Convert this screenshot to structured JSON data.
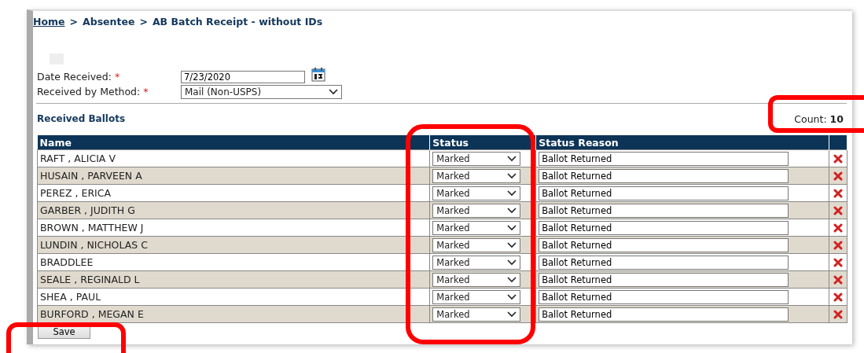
{
  "breadcrumb": [
    {
      "label": "Home",
      "kind": "link"
    },
    {
      "label": ">",
      "kind": "separator"
    },
    {
      "label": "Absentee",
      "kind": "text"
    },
    {
      "label": ">",
      "kind": "separator"
    },
    {
      "label": "AB Batch Receipt - without IDs",
      "kind": "text"
    }
  ],
  "form": {
    "date_received": {
      "label": "Date Received:",
      "required_mark": "*",
      "value": "7/23/2020"
    },
    "received_by_method": {
      "label": "Received by Method:",
      "required_mark": "*",
      "value": "Mail (Non-USPS)"
    }
  },
  "section_title": "Received Ballots",
  "count": {
    "label": "Count:",
    "value": "10"
  },
  "table": {
    "columns": [
      "Name",
      "Status",
      "Status Reason"
    ],
    "rows": [
      {
        "name": "RAFT , ALICIA V",
        "status": "Marked",
        "status_reason": "Ballot Returned"
      },
      {
        "name": "HUSAIN , PARVEEN A",
        "status": "Marked",
        "status_reason": "Ballot Returned"
      },
      {
        "name": "PEREZ , ERICA",
        "status": "Marked",
        "status_reason": "Ballot Returned"
      },
      {
        "name": "GARBER , JUDITH G",
        "status": "Marked",
        "status_reason": "Ballot Returned"
      },
      {
        "name": "BROWN , MATTHEW J",
        "status": "Marked",
        "status_reason": "Ballot Returned"
      },
      {
        "name": "LUNDIN , NICHOLAS C",
        "status": "Marked",
        "status_reason": "Ballot Returned"
      },
      {
        "name": "BRADDLEE",
        "status": "Marked",
        "status_reason": "Ballot Returned"
      },
      {
        "name": "SEALE , REGINALD L",
        "status": "Marked",
        "status_reason": "Ballot Returned"
      },
      {
        "name": "SHEA , PAUL",
        "status": "Marked",
        "status_reason": "Ballot Returned"
      },
      {
        "name": "BURFORD , MEGAN E",
        "status": "Marked",
        "status_reason": "Ballot Returned"
      }
    ]
  },
  "save_button": "Save"
}
